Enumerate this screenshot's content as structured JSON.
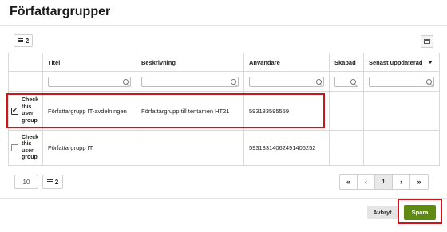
{
  "dialog": {
    "title": "Författargrupper"
  },
  "top_toolbar": {
    "list_count": "2"
  },
  "table": {
    "columns": [
      "",
      "Titel",
      "Beskrivning",
      "Användare",
      "Skapad",
      "Senast uppdaterad"
    ],
    "sorted_column": "Senast uppdaterad",
    "sort_direction": "descending",
    "rows": [
      {
        "checked": true,
        "check_label": "Check this user group",
        "titel": "Författargrupp IT-avdelningen",
        "beskrivning": "Författargrupp till tentamen HT21",
        "anvandare": "593183595559",
        "skapad": "",
        "senast": ""
      },
      {
        "checked": false,
        "check_label": "Check this user group",
        "titel": "Författargrupp IT",
        "beskrivning": "",
        "anvandare": "59318314062491406252",
        "skapad": "",
        "senast": ""
      }
    ]
  },
  "bottom_toolbar": {
    "page_size": "10",
    "list_count": "2"
  },
  "pager": {
    "first": "«",
    "prev": "‹",
    "current_page": "1",
    "next": "›",
    "last": "»"
  },
  "footer": {
    "cancel_label": "Avbryt",
    "save_label": "Spara"
  },
  "colors": {
    "highlight": "#d0131b",
    "save_button": "#5f8a14"
  }
}
